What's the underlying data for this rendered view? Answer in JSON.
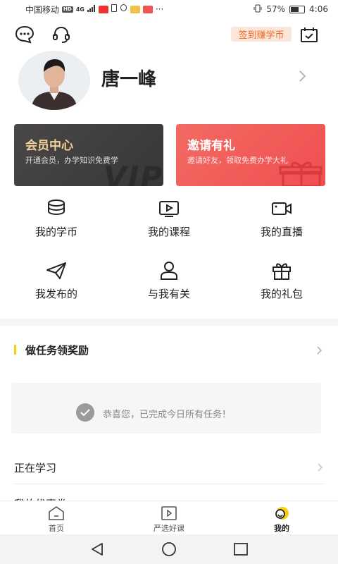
{
  "status_bar": {
    "carrier": "中国移动",
    "network_badge": "HD",
    "signal_text": "4G",
    "battery_percent": "57%",
    "time": "4:06",
    "more": "···"
  },
  "toolbar": {
    "checkin_label": "签到赚学币"
  },
  "profile": {
    "name": "唐一峰"
  },
  "cards": {
    "vip": {
      "title": "会员中心",
      "subtitle": "开通会员，办学知识免费学",
      "watermark": "VIP"
    },
    "invite": {
      "title": "邀请有礼",
      "subtitle": "邀请好友，领取免费办学大礼"
    }
  },
  "menu": [
    {
      "label": "我的学币",
      "icon": "coins-icon"
    },
    {
      "label": "我的课程",
      "icon": "video-course-icon"
    },
    {
      "label": "我的直播",
      "icon": "live-camera-icon"
    },
    {
      "label": "我发布的",
      "icon": "paper-plane-icon"
    },
    {
      "label": "与我有关",
      "icon": "person-icon"
    },
    {
      "label": "我的礼包",
      "icon": "gift-icon"
    }
  ],
  "tasks": {
    "title": "做任务领奖励",
    "done_message": "恭喜您，已完成今日所有任务！"
  },
  "list": [
    {
      "label": "正在学习"
    },
    {
      "label": "我的优惠券"
    }
  ],
  "tabbar": {
    "items": [
      {
        "label": "首页",
        "icon": "home-icon"
      },
      {
        "label": "严选好课",
        "icon": "play-course-icon"
      },
      {
        "label": "我的",
        "icon": "my-profile-icon"
      }
    ],
    "active_index": 2
  },
  "colors": {
    "accent_yellow": "#f7cf13",
    "checkin_orange": "#f06a2a",
    "vip_card": "#424040",
    "invite_card": "#f25a58",
    "vip_gold": "#f1d29a"
  }
}
